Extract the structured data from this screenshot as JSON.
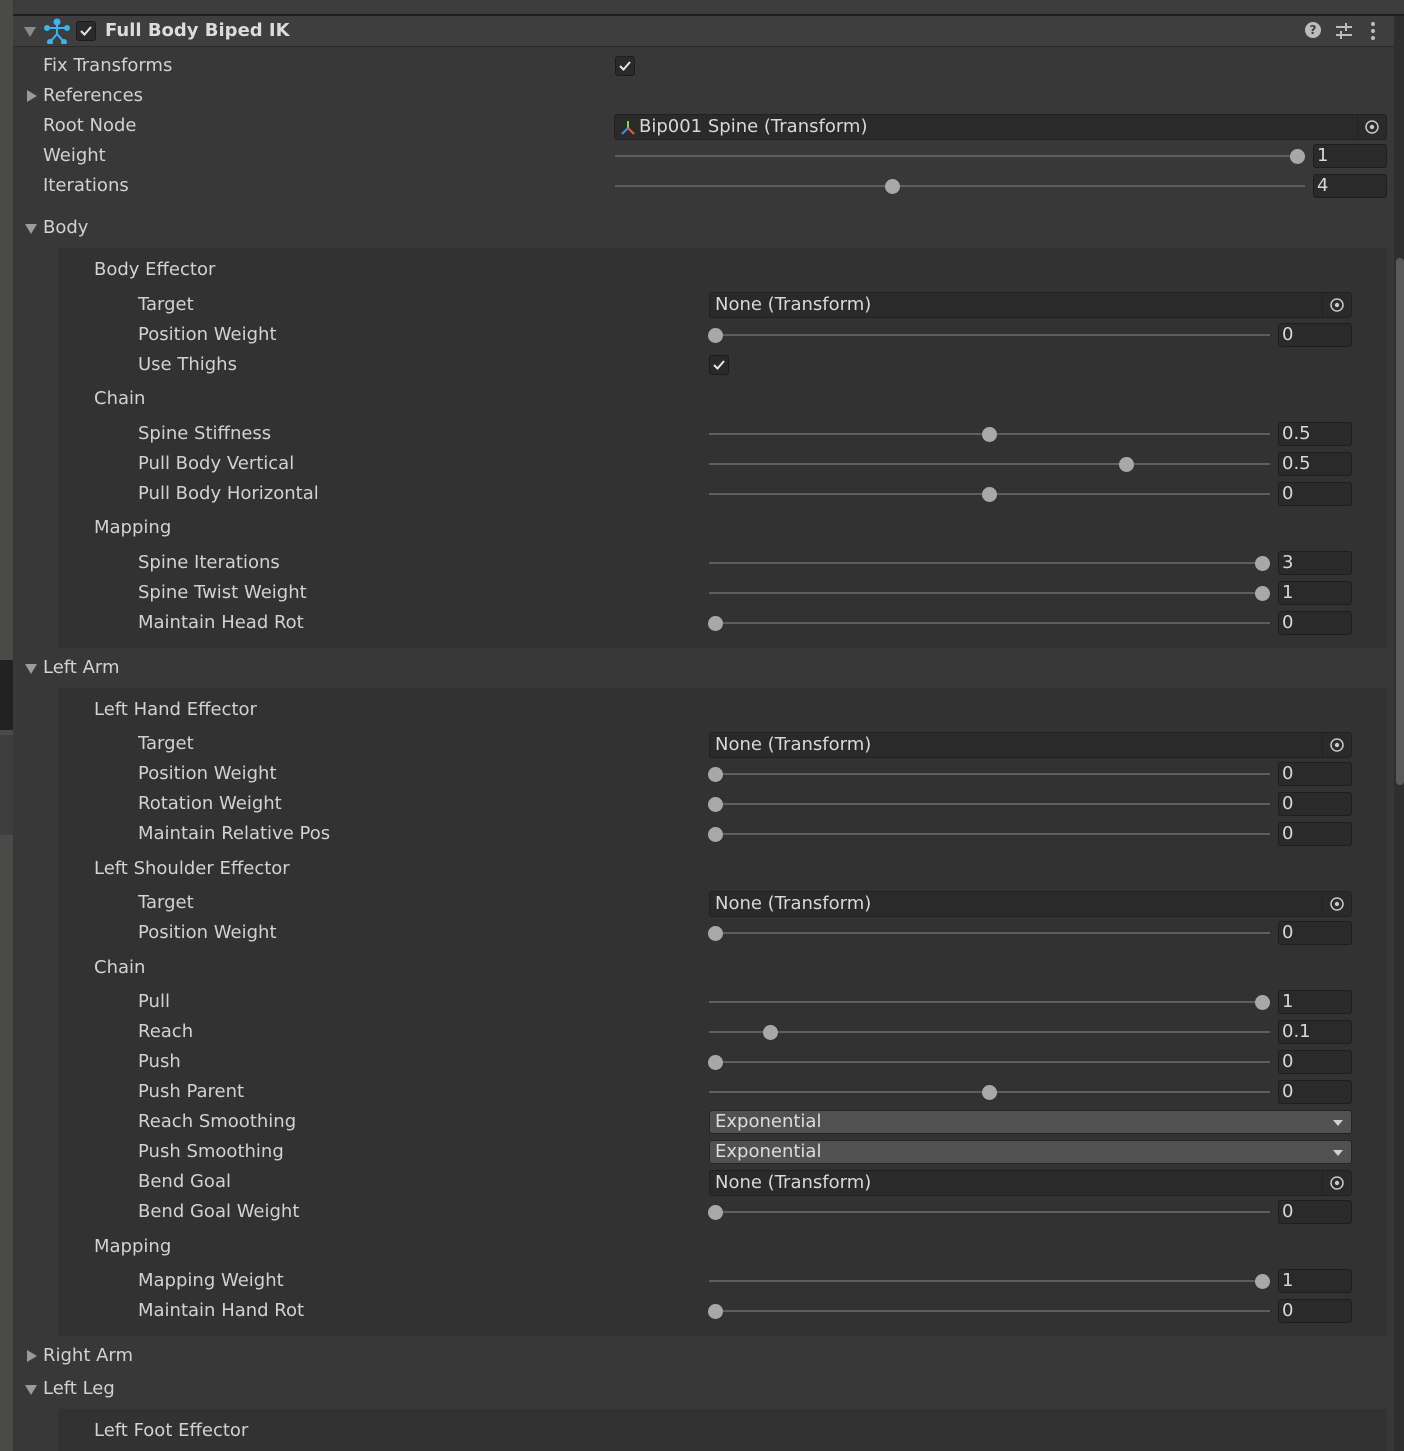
{
  "component": {
    "title": "Full Body Biped IK",
    "enabled": true
  },
  "header_icons": [
    "help-icon",
    "preset-icon",
    "more-menu-icon"
  ],
  "top_fields": {
    "fix_transforms": {
      "label": "Fix Transforms",
      "checked": true
    },
    "references": {
      "label": "References"
    },
    "root_node": {
      "label": "Root Node",
      "value": "Bip001 Spine (Transform)"
    },
    "weight": {
      "label": "Weight",
      "value": "1",
      "fraction": 1.0
    },
    "iterations": {
      "label": "Iterations",
      "value": "4",
      "fraction": 0.4
    }
  },
  "body": {
    "label": "Body",
    "body_effector": {
      "label": "Body Effector",
      "target": {
        "label": "Target",
        "value": "None (Transform)"
      },
      "position_weight": {
        "label": "Position Weight",
        "value": "0",
        "fraction": 0
      },
      "use_thighs": {
        "label": "Use Thighs",
        "checked": true
      }
    },
    "chain": {
      "label": "Chain",
      "spine_stiffness": {
        "label": "Spine Stiffness",
        "value": "0.5",
        "fraction": 0.5
      },
      "pull_body_vertical": {
        "label": "Pull Body Vertical",
        "value": "0.5",
        "fraction": 0.75
      },
      "pull_body_horizontal": {
        "label": "Pull Body Horizontal",
        "value": "0",
        "fraction": 0.5
      }
    },
    "mapping": {
      "label": "Mapping",
      "spine_iterations": {
        "label": "Spine Iterations",
        "value": "3",
        "fraction": 1.0
      },
      "spine_twist_weight": {
        "label": "Spine Twist Weight",
        "value": "1",
        "fraction": 1.0
      },
      "maintain_head_rot": {
        "label": "Maintain Head Rot",
        "value": "0",
        "fraction": 0
      }
    }
  },
  "left_arm": {
    "label": "Left Arm",
    "hand_effector": {
      "label": "Left Hand Effector",
      "target": {
        "label": "Target",
        "value": "None (Transform)"
      },
      "position_weight": {
        "label": "Position Weight",
        "value": "0",
        "fraction": 0
      },
      "rotation_weight": {
        "label": "Rotation Weight",
        "value": "0",
        "fraction": 0
      },
      "maintain_relative_pos": {
        "label": "Maintain Relative Pos",
        "value": "0",
        "fraction": 0
      }
    },
    "shoulder_effector": {
      "label": "Left Shoulder Effector",
      "target": {
        "label": "Target",
        "value": "None (Transform)"
      },
      "position_weight": {
        "label": "Position Weight",
        "value": "0",
        "fraction": 0
      }
    },
    "chain": {
      "label": "Chain",
      "pull": {
        "label": "Pull",
        "value": "1",
        "fraction": 1.0
      },
      "reach": {
        "label": "Reach",
        "value": "0.1",
        "fraction": 0.1
      },
      "push": {
        "label": "Push",
        "value": "0",
        "fraction": 0
      },
      "push_parent": {
        "label": "Push Parent",
        "value": "0",
        "fraction": 0.5
      },
      "reach_smoothing": {
        "label": "Reach Smoothing",
        "value": "Exponential"
      },
      "push_smoothing": {
        "label": "Push Smoothing",
        "value": "Exponential"
      },
      "bend_goal": {
        "label": "Bend Goal",
        "value": "None (Transform)"
      },
      "bend_goal_weight": {
        "label": "Bend Goal Weight",
        "value": "0",
        "fraction": 0
      }
    },
    "mapping": {
      "label": "Mapping",
      "mapping_weight": {
        "label": "Mapping Weight",
        "value": "1",
        "fraction": 1.0
      },
      "maintain_hand_rot": {
        "label": "Maintain Hand Rot",
        "value": "0",
        "fraction": 0
      }
    }
  },
  "right_arm": {
    "label": "Right Arm"
  },
  "left_leg": {
    "label": "Left Leg",
    "foot_effector": {
      "label": "Left Foot Effector"
    }
  },
  "colors": {
    "background": "#383838",
    "section": "#323232",
    "field": "#2a2a2a",
    "accent_icon": "#3ab4f2"
  }
}
